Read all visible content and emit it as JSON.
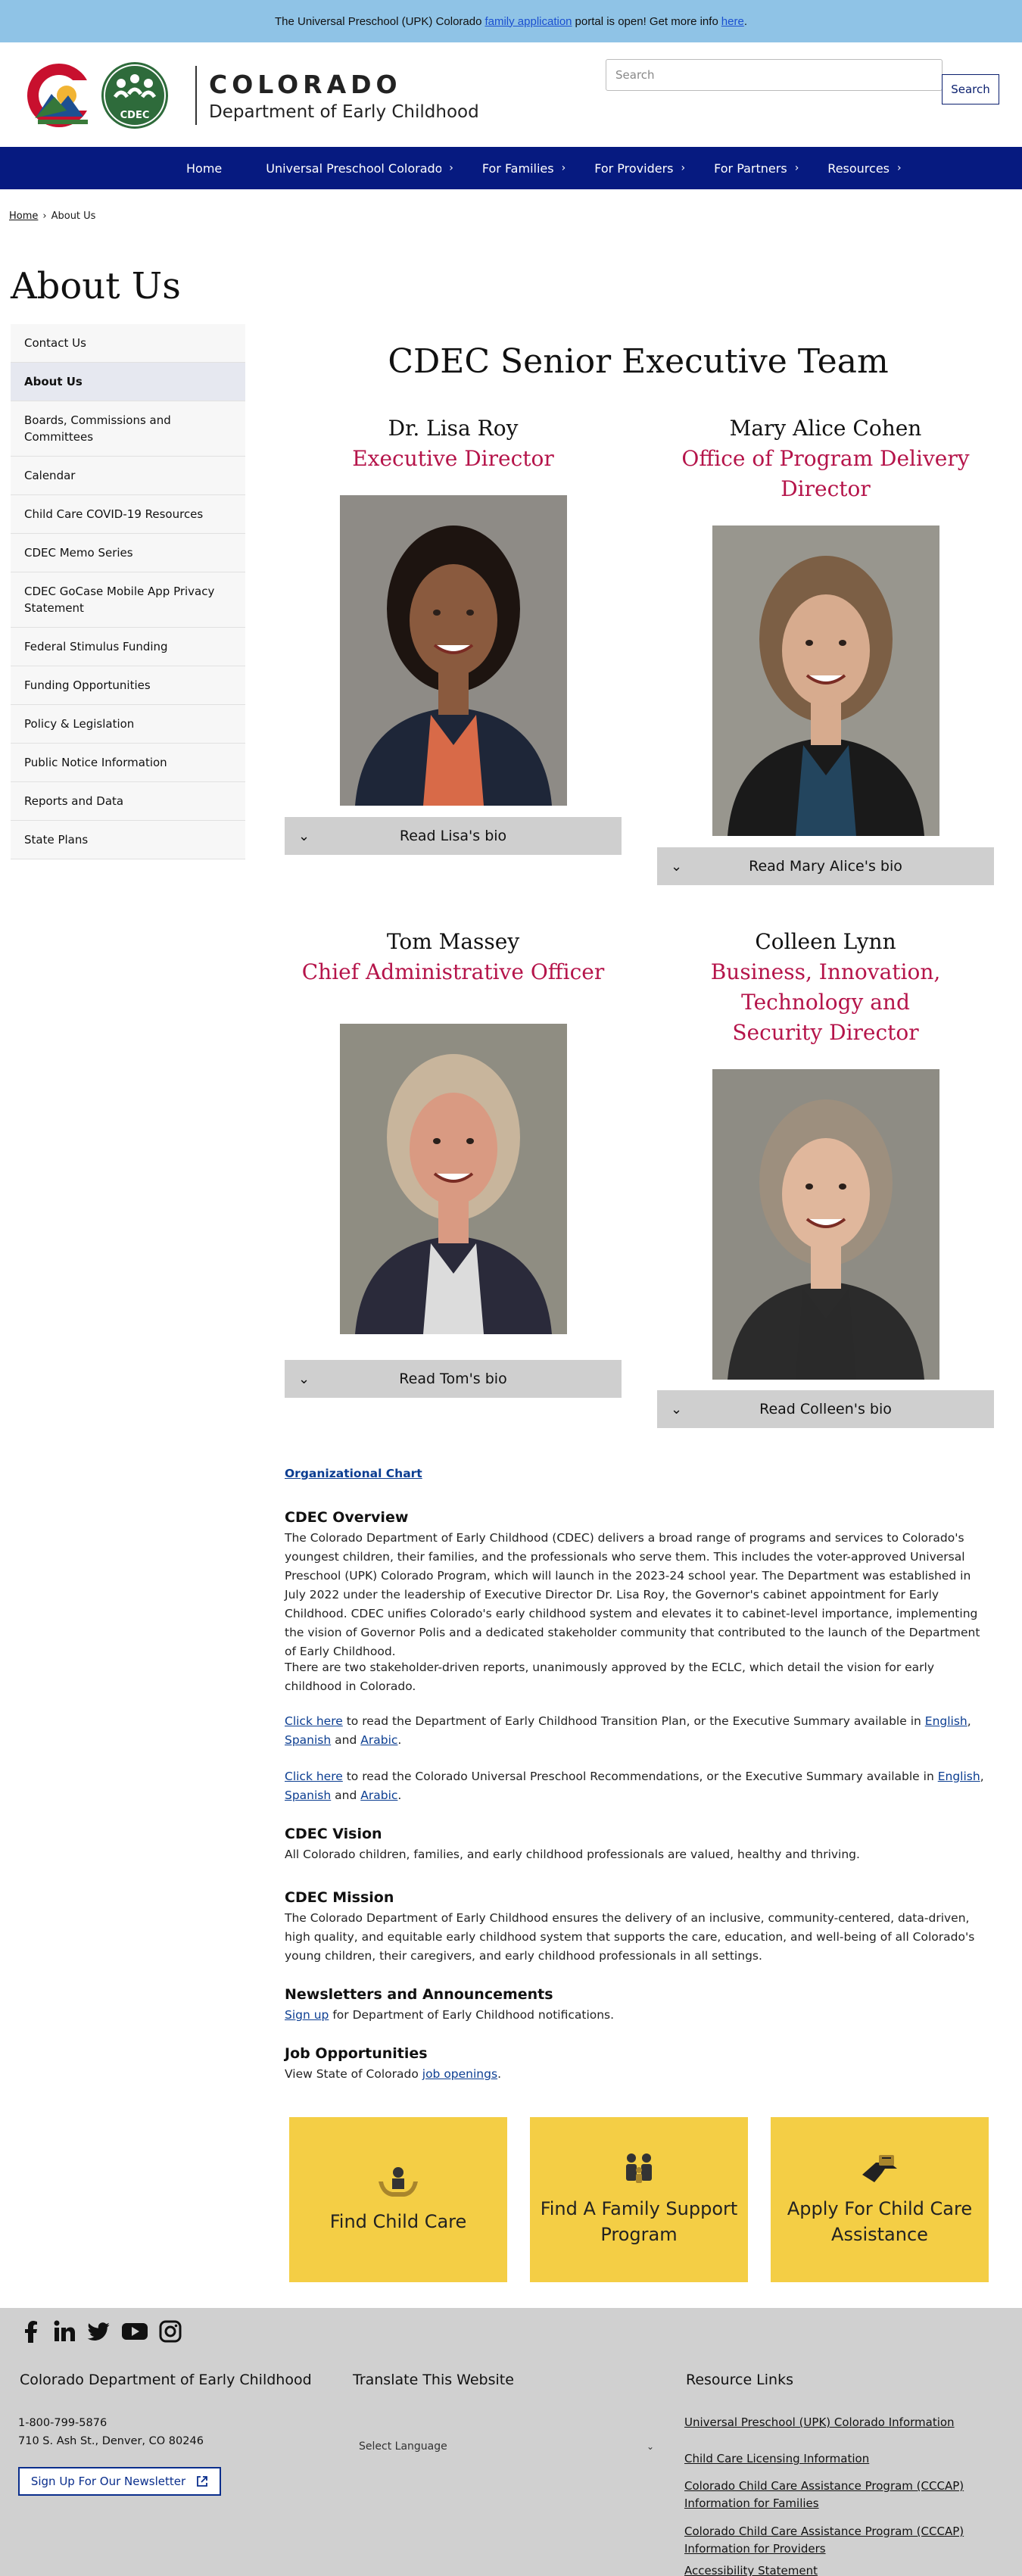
{
  "alert": {
    "text_before": "The Universal Preschool (UPK) Colorado",
    "link_family": "family application",
    "text_middle": "portal is open! Get more info",
    "link_here": "here",
    "text_end": "."
  },
  "header": {
    "state": "COLORADO",
    "department": "Department of Early Childhood",
    "logo_badge": "CDEC",
    "search_placeholder": "Search",
    "search_button": "Search"
  },
  "nav": {
    "items": [
      {
        "label": "Home",
        "has_children": false
      },
      {
        "label": "Universal Preschool Colorado",
        "has_children": true
      },
      {
        "label": "For Families",
        "has_children": true
      },
      {
        "label": "For Providers",
        "has_children": true
      },
      {
        "label": "For Partners",
        "has_children": true
      },
      {
        "label": "Resources",
        "has_children": true
      }
    ]
  },
  "breadcrumb": {
    "home": "Home",
    "separator": "›",
    "current": "About Us"
  },
  "page": {
    "title": "About Us"
  },
  "sidebar": {
    "items": [
      "Contact Us",
      "About Us",
      "Boards, Commissions and Committees",
      "Calendar",
      "Child Care COVID-19 Resources",
      "CDEC Memo Series",
      "CDEC GoCase Mobile App Privacy Statement",
      "Federal Stimulus Funding",
      "Funding Opportunities",
      "Policy & Legislation",
      "Public Notice Information",
      "Reports and Data",
      "State Plans"
    ],
    "active": "About Us"
  },
  "team": {
    "title": "CDEC Senior Executive Team",
    "members": [
      {
        "name": "Dr. Lisa Roy",
        "role": "Executive Director",
        "bio_label": "Read Lisa's bio",
        "bg": "#8e8b86",
        "skin": "#8a5a3e",
        "hair": "#1d1410",
        "shirt": "#d86a48",
        "jacket": "#1e2638"
      },
      {
        "name": "Mary Alice Cohen",
        "role": "Office of Program Delivery Director",
        "bio_label": "Read Mary Alice's bio",
        "bg": "#98968e",
        "skin": "#d7ab8e",
        "hair": "#7c5f45",
        "shirt": "#23455e",
        "jacket": "#1a1a1a"
      },
      {
        "name": "Tom Massey",
        "role": "Chief Administrative Officer",
        "bio_label": "Read Tom's bio",
        "bg": "#8f8d82",
        "skin": "#d99a82",
        "hair": "#c8b59c",
        "shirt": "#dcdcdc",
        "jacket": "#2a2a3a"
      },
      {
        "name": "Colleen Lynn",
        "role": "Business, Innovation, Technology and Security Director",
        "bio_label": "Read Colleen's bio",
        "bg": "#8e8c84",
        "skin": "#e0b79c",
        "hair": "#9d8f7e",
        "shirt": "#2a2a2a",
        "jacket": "#2b2b2b"
      }
    ]
  },
  "content": {
    "org_chart_link": "Organizational Chart",
    "overview_title": "CDEC Overview",
    "overview_p1": "The Colorado Department of Early Childhood (CDEC) delivers a broad range of programs and services to Colorado's youngest children, their families, and the professionals who serve them. This includes the voter-approved Universal Preschool (UPK) Colorado Program, which will launch in the 2023-24 school year. The Department was established in July 2022 under the leadership of Executive Director Dr. Lisa Roy, the Governor's cabinet appointment for Early Childhood. CDEC unifies Colorado's early childhood system and elevates it to cabinet-level importance, implementing the vision of Governor Polis and a dedicated stakeholder community that contributed to the launch of the Department of Early Childhood.",
    "overview_p2": "There are two stakeholder-driven reports, unanimously approved by the ECLC, which detail the vision for early childhood in Colorado.",
    "click_here": "Click here",
    "p3_text": "to read the Department of Early Childhood Transition Plan, or the Executive Summary available in",
    "p4_text": "to read the Colorado Universal Preschool Recommendations, or the Executive Summary available in",
    "lang_english": "English",
    "lang_spanish": "Spanish",
    "lang_and": "and",
    "lang_arabic": "Arabic",
    "comma": ",",
    "period": ".",
    "vision_title": "CDEC Vision",
    "vision_text": "All Colorado children, families, and early childhood professionals are valued, healthy and thriving.",
    "mission_title": "CDEC Mission",
    "mission_text": "The Colorado Department of Early Childhood ensures the delivery of an inclusive, community-centered, data-driven, high quality, and equitable early childhood system that supports the care, education, and well-being of all Colorado's young children, their caregivers, and early childhood professionals in all settings.",
    "news_title": "Newsletters and Announcements",
    "news_link": "Sign up",
    "news_text": "for Department of Early Childhood notifications.",
    "jobs_title": "Job Opportunities",
    "jobs_text": "View State of Colorado",
    "jobs_link": "job openings",
    "jobs_end": "."
  },
  "cards": [
    {
      "label": "Find Child Care",
      "icon": "child-care-icon"
    },
    {
      "label": "Find A Family Support Program",
      "icon": "family-icon"
    },
    {
      "label": "Apply For Child Care Assistance",
      "icon": "assistance-icon"
    }
  ],
  "footer": {
    "org_title": "Colorado Department of Early Childhood",
    "phone": "1-800-799-5876",
    "address": "710 S. Ash St., Denver, CO 80246",
    "newsletter_button": "Sign Up For Our Newsletter",
    "translate_title": "Translate This Website",
    "select_language": "Select Language",
    "resources_title": "Resource Links",
    "resource_links": [
      "Universal Preschool (UPK) Colorado Information",
      "Child Care Licensing Information",
      "Colorado Child Care Assistance Program (CCCAP) Information for Families",
      "Colorado Child Care Assistance Program (CCCAP) Information for Providers",
      "Accessibility Statement"
    ],
    "social": [
      "facebook-icon",
      "linkedin-icon",
      "twitter-icon",
      "youtube-icon",
      "instagram-icon"
    ]
  },
  "colors": {
    "alert_bg": "#8fc3e6",
    "nav_bg": "#061a80",
    "role_color": "#b5144a",
    "bio_button": "#cfcfcf",
    "card_yellow": "#f4ce45",
    "footer_bg": "#d0d0d0"
  }
}
